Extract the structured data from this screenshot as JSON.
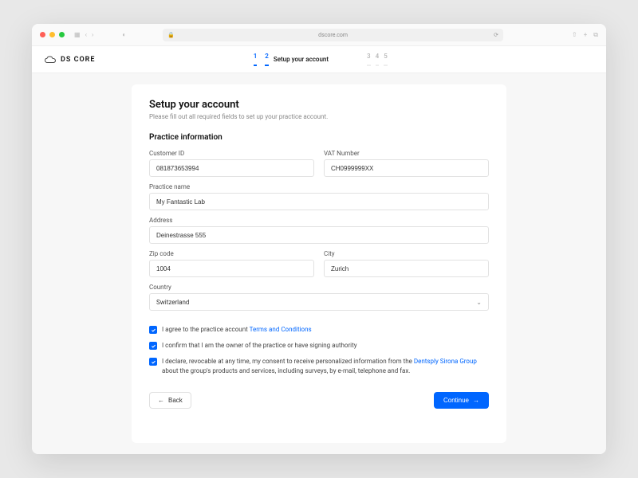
{
  "browser": {
    "url_display": "dscore.com"
  },
  "brand": "DS CORE",
  "stepper": {
    "steps": [
      "1",
      "2",
      "3",
      "4",
      "5"
    ],
    "active_label": "Setup your account"
  },
  "page": {
    "title": "Setup your account",
    "subtitle": "Please fill out all required fields to set up your practice account."
  },
  "section": {
    "title": "Practice information"
  },
  "fields": {
    "customer_id": {
      "label": "Customer ID",
      "value": "081873653994"
    },
    "vat": {
      "label": "VAT Number",
      "value": "CH0999999XX"
    },
    "practice_name": {
      "label": "Practice name",
      "value": "My Fantastic Lab"
    },
    "address": {
      "label": "Address",
      "value": "Deinestrasse 555"
    },
    "zip": {
      "label": "Zip code",
      "value": "1004"
    },
    "city": {
      "label": "City",
      "value": "Zurich"
    },
    "country": {
      "label": "Country",
      "value": "Switzerland"
    }
  },
  "consents": {
    "c1_pre": "I agree to the practice account ",
    "c1_link": "Terms and Conditions",
    "c2": "I confirm that I am the owner of the practice or have signing authority",
    "c3_pre": "I declare, revocable at any time, my consent to receive personalized information from the ",
    "c3_link": "Dentsply Sirona Group",
    "c3_post": " about the group's products and services, including surveys, by e-mail, telephone and fax."
  },
  "buttons": {
    "back": "Back",
    "continue": "Continue"
  },
  "colors": {
    "accent": "#0066ff"
  }
}
